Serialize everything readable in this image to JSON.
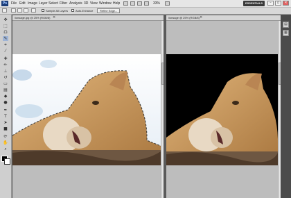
{
  "app": {
    "logo_text": "Ps"
  },
  "menus": [
    "File",
    "Edit",
    "Image",
    "Layer",
    "Select",
    "Filter",
    "Analysis",
    "3D",
    "View",
    "Window",
    "Help"
  ],
  "menubar": {
    "zoom": "33%",
    "workspace": "ESSENTIALS"
  },
  "window_controls": {
    "minimize": "–",
    "maximize": "▫",
    "close": "✕"
  },
  "options": {
    "sample_all_layers": "Sample All Layers",
    "auto_enhance": "Auto-Enhance",
    "refine_edge": "Refine Edge..."
  },
  "documents": {
    "left": {
      "tab": "lionsage.jpg @ 25% (RGB/8)",
      "close": "×"
    },
    "right": {
      "tab": "lionsage @ 25% (RGB/8)",
      "close": "×"
    }
  },
  "colors": {
    "background_panel": "#5a5a5a",
    "canvas_gray": "#bdbdbd",
    "sky_white": "#eef3f8",
    "fur_tan": "#c89a62",
    "foreground": "#000000",
    "background": "#ffffff"
  },
  "icons": {
    "tools": [
      "move-icon",
      "marquee-icon",
      "lasso-icon",
      "quick-selection-icon",
      "crop-icon",
      "eyedropper-icon",
      "healing-brush-icon",
      "brush-icon",
      "clone-stamp-icon",
      "history-brush-icon",
      "eraser-icon",
      "gradient-icon",
      "blur-icon",
      "dodge-icon",
      "pen-icon",
      "type-icon",
      "path-selection-icon",
      "shape-icon",
      "3d-rotate-icon",
      "3d-camera-icon",
      "hand-icon",
      "zoom-icon"
    ]
  }
}
